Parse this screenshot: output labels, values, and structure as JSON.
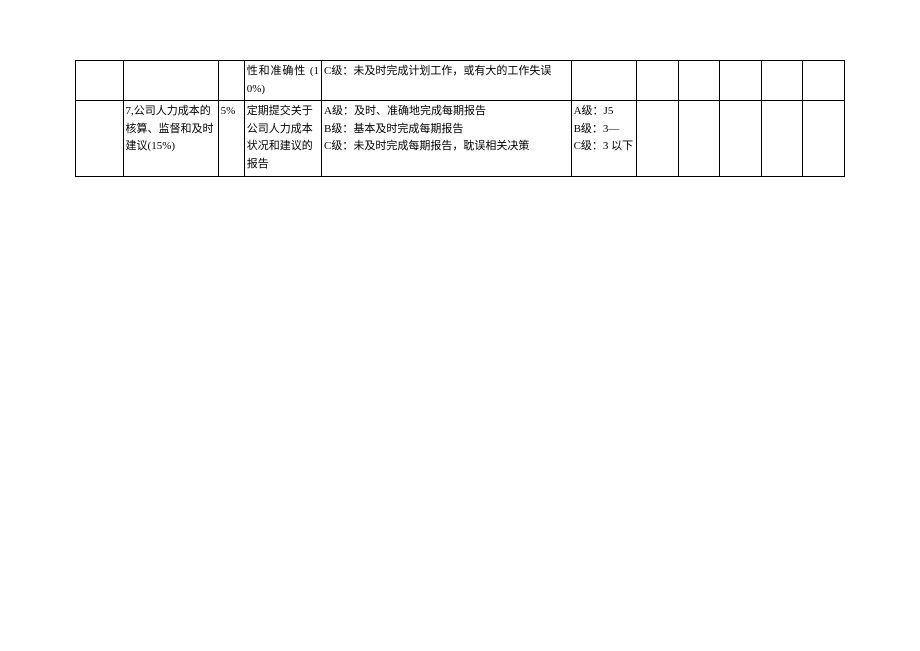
{
  "rows": [
    {
      "col_a": "",
      "col_b": "",
      "col_c": "",
      "col_d": "性和准确性 (10%)",
      "col_e": "C级：未及时完成计划工作，或有大的工作失误",
      "col_f": "",
      "col_g": "",
      "col_h": "",
      "col_i": "",
      "col_j": "",
      "col_k": ""
    },
    {
      "col_a": "",
      "col_b": "7,公司人力成本的核算、监督和及时建议(15%)",
      "col_c": "5%",
      "col_d": "定期提交关于公司人力成本状况和建议的报告",
      "col_e_line1": "A级：及时、准确地完成每期报告",
      "col_e_line2": "B级：基本及时完成每期报告",
      "col_e_line3": "C级：未及时完成每期报告，耽误相关决策",
      "col_f_line1": "A级：J5",
      "col_f_line2": "B级：3—",
      "col_f_line3": "C级：3 以下",
      "col_g": "",
      "col_h": "",
      "col_i": "",
      "col_j": "",
      "col_k": ""
    }
  ]
}
